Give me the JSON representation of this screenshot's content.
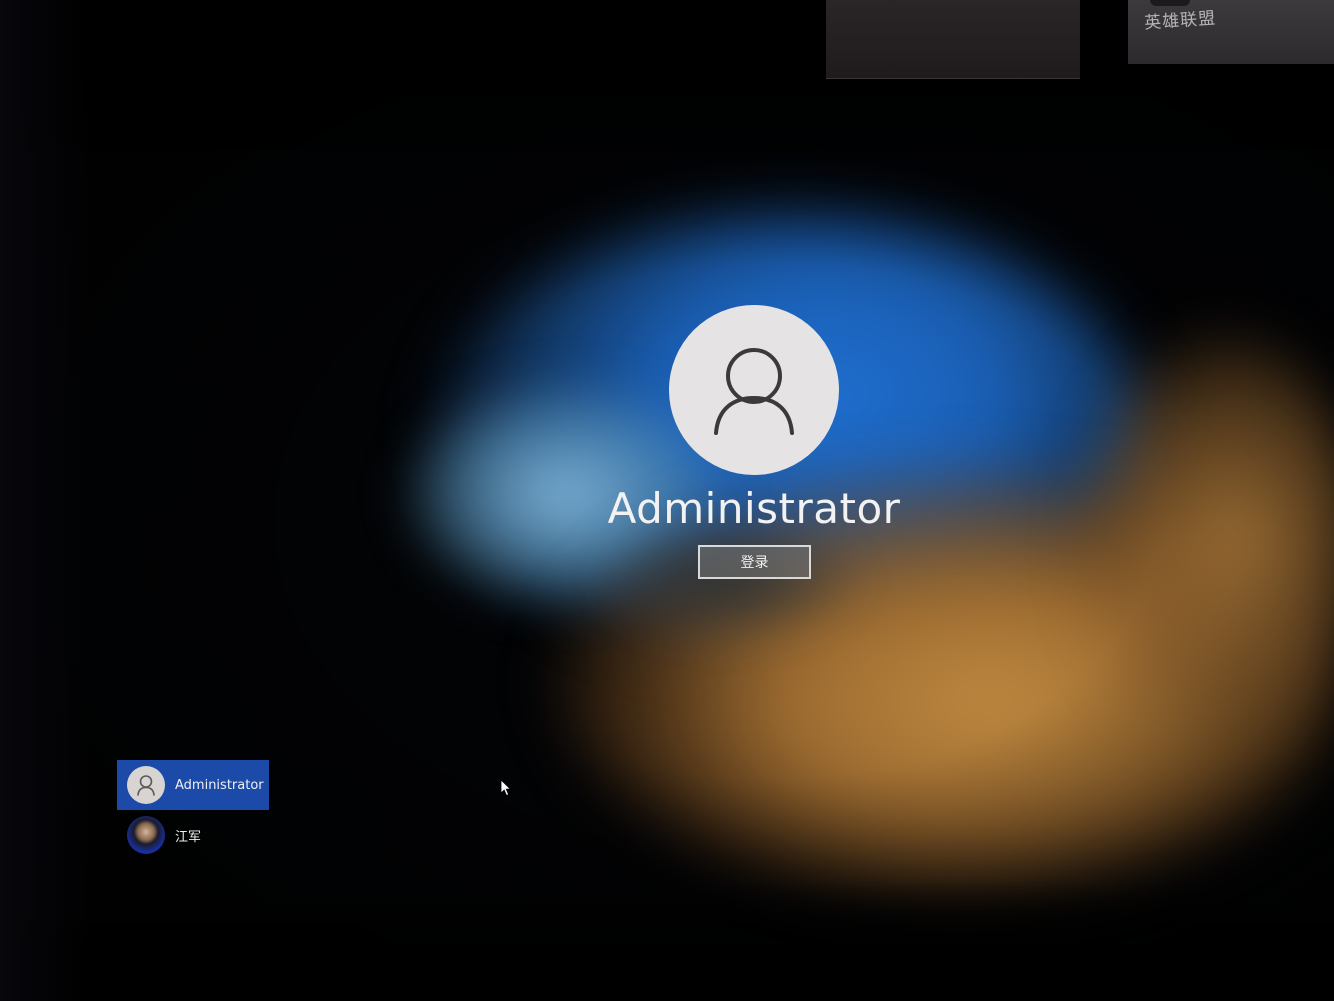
{
  "login": {
    "username": "Administrator",
    "sign_in_label": "登录"
  },
  "user_list": [
    {
      "name": "Administrator",
      "selected": true,
      "avatar": "default-user-icon"
    },
    {
      "name": "江军",
      "selected": false,
      "avatar": "user-photo"
    }
  ],
  "background_window": {
    "label": "英雄联盟"
  },
  "colors": {
    "selected_user_bg": "#1c4aa8",
    "avatar_bg": "#e6e3e5",
    "text": "#f2f2f2"
  }
}
